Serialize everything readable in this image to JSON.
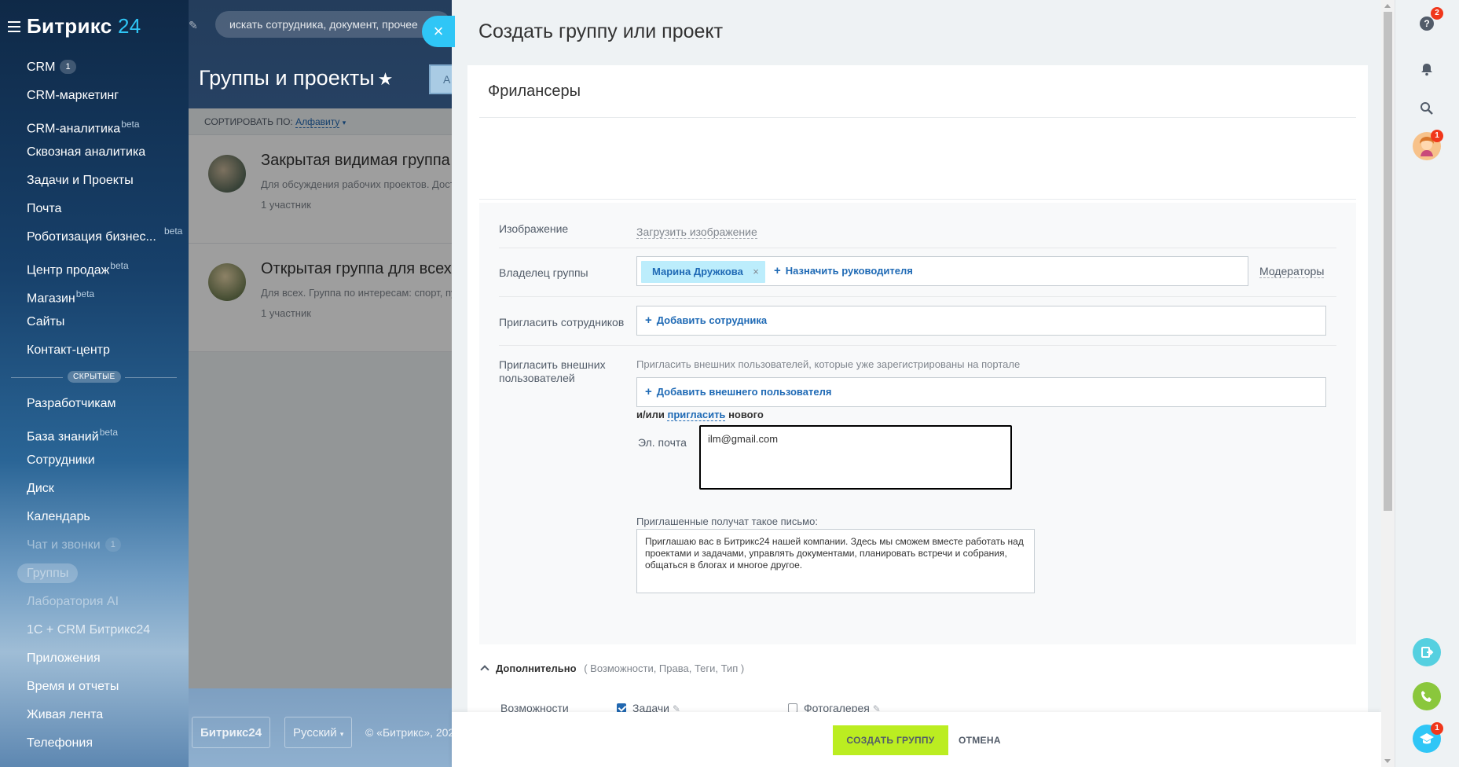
{
  "sidebar": {
    "logo_text": "Битрикс",
    "logo_num": "24",
    "items": [
      {
        "label": "CRM",
        "counter": "1"
      },
      {
        "label": "CRM-маркетинг"
      },
      {
        "label": "CRM-аналитика",
        "sup": "beta"
      },
      {
        "label": "Сквозная аналитика"
      },
      {
        "label": "Задачи и Проекты"
      },
      {
        "label": "Почта"
      },
      {
        "label": "Роботизация бизнес...",
        "sup": "beta"
      },
      {
        "label": "Центр продаж",
        "sup": "beta"
      },
      {
        "label": "Магазин",
        "sup": "beta"
      },
      {
        "label": "Сайты"
      },
      {
        "label": "Контакт-центр"
      }
    ],
    "hidden_label": "СКРЫТЫЕ",
    "hidden_items": [
      {
        "label": "Разработчикам"
      },
      {
        "label": "База знаний",
        "sup": "beta"
      },
      {
        "label": "Сотрудники"
      },
      {
        "label": "Диск"
      },
      {
        "label": "Календарь"
      },
      {
        "label": "Чат и звонки",
        "counter": "1"
      },
      {
        "label": "Группы"
      },
      {
        "label": "Лаборатория AI"
      },
      {
        "label": "1С + CRM Битрикс24"
      },
      {
        "label": "Приложения"
      },
      {
        "label": "Время и отчеты"
      },
      {
        "label": "Живая лента"
      },
      {
        "label": "Телефония"
      }
    ]
  },
  "topbar": {
    "search_placeholder": "искать сотрудника, документ, прочее"
  },
  "page": {
    "title": "Группы и проекты",
    "title_button": "А",
    "sort_label": "СОРТИРОВАТЬ ПО:",
    "sort_value": "Алфавиту",
    "groups": [
      {
        "name": "Закрытая видимая группа",
        "desc": "Для обсуждения рабочих проектов. Дост",
        "count": "1 участник"
      },
      {
        "name": "Открытая группа для всех",
        "desc": "Для всех. Группа по интересам: спорт, пу",
        "count": "1 участник"
      }
    ],
    "footer_logo": "Битрикс24",
    "footer_lang": "Русский",
    "footer_copyright": "© «Битрикс», 202"
  },
  "slider": {
    "title": "Создать группу или проект",
    "group_name": "Фрилансеры",
    "image_label": "Изображение",
    "image_link": "Загрузить изображение",
    "owner_label": "Владелец группы",
    "owner_name": "Марина Дружкова",
    "owner_remove": "×",
    "assign_head": "Назначить руководителя",
    "moderators": "Модераторы",
    "invite_label": "Пригласить сотрудников",
    "add_employee": "Добавить сотрудника",
    "external_label_1": "Пригласить внешних",
    "external_label_2": "пользователей",
    "external_hint": "Пригласить внешних пользователей, которые уже зарегистрированы на портале",
    "add_external": "Добавить внешнего пользователя",
    "or_text": "и/или",
    "invite_link": "пригласить",
    "new_text": "нового",
    "email_label": "Эл. почта",
    "email_value": "ilm@gmail.com",
    "letter_label": "Приглашенные получат такое письмо:",
    "letter_text": "Приглашаю вас в Битрикс24 нашей компании. Здесь мы сможем вместе работать над проектами и задачами, управлять документами, планировать встречи и собрания, общаться в блогах и многое другое.",
    "more_title": "Дополнительно",
    "more_hint": "( Возможности,  Права,  Теги,  Тип  )",
    "features_label": "Возможности",
    "feature_tasks": "Задачи",
    "feature_photo": "Фотогалерея",
    "create_button": "СОЗДАТЬ ГРУППУ",
    "cancel_button": "ОТМЕНА"
  },
  "right_rail": {
    "help_badge": "2",
    "avatar_badge": "1",
    "edu_badge": "1"
  },
  "colors": {
    "accent": "#2fc6f6",
    "create_button": "#bbed21",
    "link": "#1f6ab5",
    "tag_bg": "#bcedfc"
  }
}
